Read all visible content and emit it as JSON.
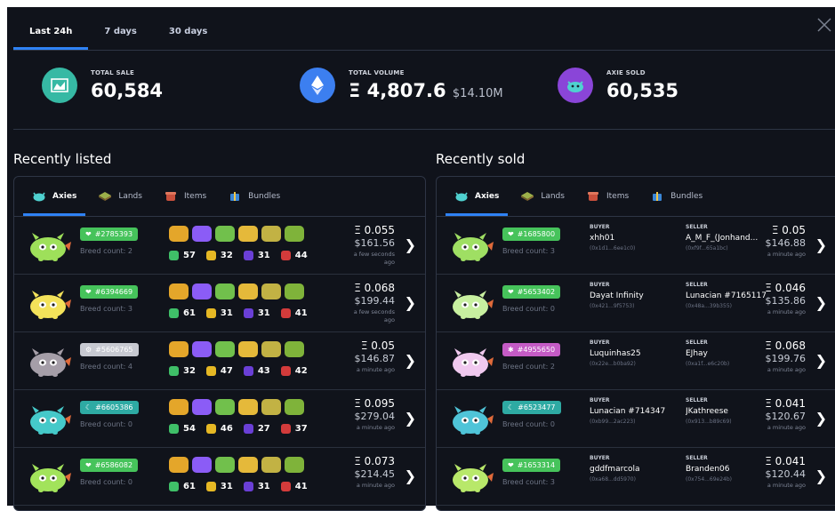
{
  "time_tabs": [
    "Last 24h",
    "7 days",
    "30 days"
  ],
  "stats": {
    "total_sale": {
      "label": "TOTAL SALE",
      "value": "60,584"
    },
    "total_volume": {
      "label": "TOTAL VOLUME",
      "value": "Ξ 4,807.6",
      "usd": "$14.10M"
    },
    "axie_sold": {
      "label": "AXIE SOLD",
      "value": "60,535"
    }
  },
  "recently_listed": {
    "title": "Recently listed",
    "tabs": [
      "Axies",
      "Lands",
      "Items",
      "Bundles"
    ],
    "rows": [
      {
        "id": "#2785393",
        "class_icon": "heart",
        "badge_color": "#46c35b",
        "axie_color": "#9ee05a",
        "breed": "Breed count: 2",
        "stats": [
          "57",
          "32",
          "31",
          "44"
        ],
        "eth": "Ξ 0.055",
        "usd": "$161.56",
        "time": [
          "a few seconds",
          "ago"
        ]
      },
      {
        "id": "#6394669",
        "class_icon": "heart",
        "badge_color": "#46c35b",
        "axie_color": "#f3e25a",
        "breed": "Breed count: 3",
        "stats": [
          "61",
          "31",
          "31",
          "41"
        ],
        "eth": "Ξ 0.068",
        "usd": "$199.44",
        "time": [
          "a few seconds",
          "ago"
        ]
      },
      {
        "id": "#5606765",
        "class_icon": "gear",
        "badge_color": "#c7c9d1",
        "axie_color": "#a59ea8",
        "breed": "Breed count: 4",
        "stats": [
          "32",
          "47",
          "43",
          "42"
        ],
        "eth": "Ξ 0.05",
        "usd": "$146.87",
        "time": [
          "a minute ago"
        ]
      },
      {
        "id": "#6605386",
        "class_icon": "moon",
        "badge_color": "#2eaaa3",
        "axie_color": "#45c9c9",
        "breed": "Breed count: 0",
        "stats": [
          "54",
          "46",
          "27",
          "37"
        ],
        "eth": "Ξ 0.095",
        "usd": "$279.04",
        "time": [
          "a minute ago"
        ]
      },
      {
        "id": "#6586082",
        "class_icon": "heart",
        "badge_color": "#46c35b",
        "axie_color": "#a2e35b",
        "breed": "Breed count: 0",
        "stats": [
          "61",
          "31",
          "31",
          "41"
        ],
        "eth": "Ξ 0.073",
        "usd": "$214.45",
        "time": [
          "a minute ago"
        ]
      }
    ]
  },
  "recently_sold": {
    "title": "Recently sold",
    "tabs": [
      "Axies",
      "Lands",
      "Items",
      "Bundles"
    ],
    "buyer_label": "BUYER",
    "seller_label": "SELLER",
    "rows": [
      {
        "id": "#1685800",
        "class_icon": "heart",
        "badge_color": "#46c35b",
        "axie_color": "#9fdf63",
        "breed": "Breed count: 3",
        "buyer": "xhh01",
        "buyer_addr": "(0x1d1...6ee1c0)",
        "seller": "A_M_F_(Jonhand...",
        "seller_addr": "(0xf9f...65a1bc)",
        "eth": "Ξ 0.05",
        "usd": "$146.88",
        "time": "a minute ago"
      },
      {
        "id": "#5653402",
        "class_icon": "heart",
        "badge_color": "#46c35b",
        "axie_color": "#c8f0a0",
        "breed": "Breed count: 0",
        "buyer": "Dayat Infinity",
        "buyer_addr": "(0x421...9f5753)",
        "seller": "Lunacian #7165117",
        "seller_addr": "(0x48a...39b355)",
        "eth": "Ξ 0.046",
        "usd": "$135.86",
        "time": "a minute ago"
      },
      {
        "id": "#4955650",
        "class_icon": "bug",
        "badge_color": "#c45bc5",
        "axie_color": "#f0c9ef",
        "breed": "Breed count: 2",
        "buyer": "Luquinhas25",
        "buyer_addr": "(0x22e...b0ba92)",
        "seller": "EJhay",
        "seller_addr": "(0xa1f...e6c20b)",
        "eth": "Ξ 0.068",
        "usd": "$199.76",
        "time": "a minute ago"
      },
      {
        "id": "#6523477",
        "class_icon": "moon",
        "badge_color": "#2eaaa3",
        "axie_color": "#4fc4d8",
        "breed": "Breed count: 0",
        "buyer": "Lunacian #714347",
        "buyer_addr": "(0xb99...2ac223)",
        "seller": "JKathreese",
        "seller_addr": "(0x913...b89c69)",
        "eth": "Ξ 0.041",
        "usd": "$120.67",
        "time": "a minute ago"
      },
      {
        "id": "#1653314",
        "class_icon": "heart",
        "badge_color": "#46c35b",
        "axie_color": "#b8e86a",
        "breed": "Breed count: 3",
        "buyer": "gddfmarcola",
        "buyer_addr": "(0xa68...dd5970)",
        "seller": "Branden06",
        "seller_addr": "(0x754...69e24b)",
        "eth": "Ξ 0.041",
        "usd": "$120.44",
        "time": "a minute ago"
      }
    ]
  }
}
